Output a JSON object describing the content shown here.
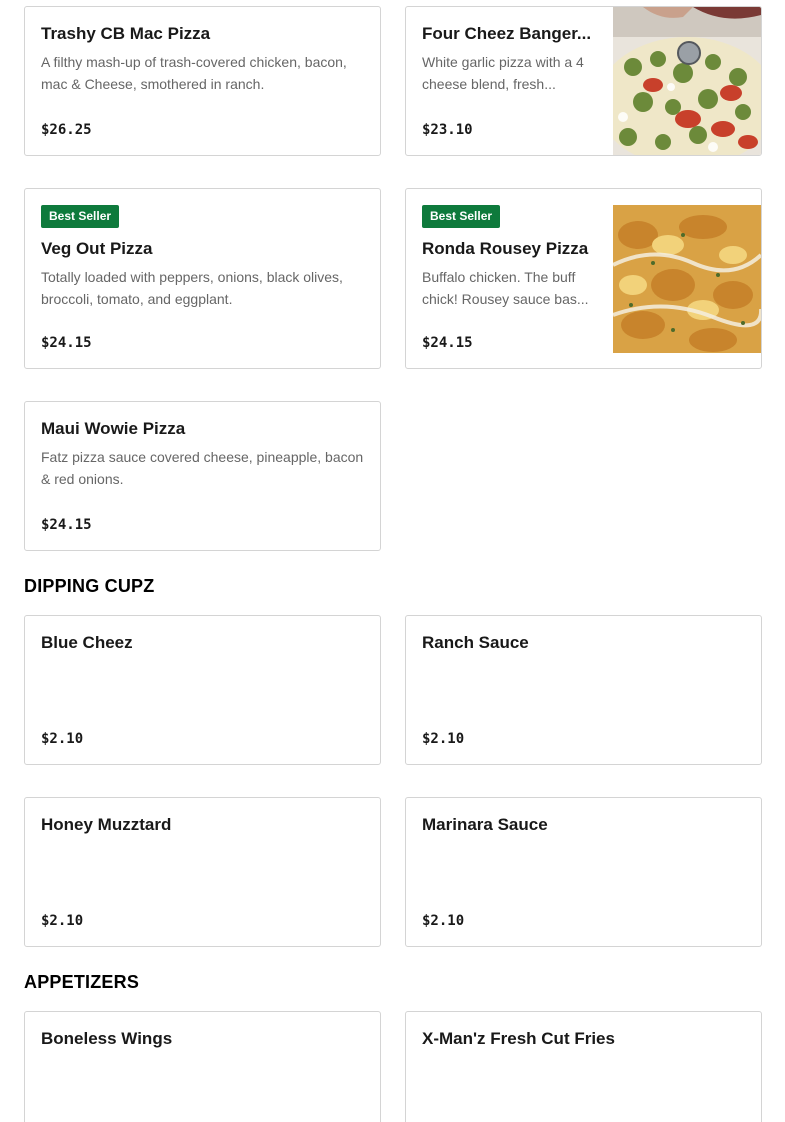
{
  "sections": {
    "pizza": {
      "items": [
        {
          "name": "Trashy CB Mac Pizza",
          "desc": "A filthy mash-up of trash-covered chicken, bacon, mac & Cheese, smothered in ranch.",
          "price": "$26.25"
        },
        {
          "name": "Four Cheez Banger...",
          "desc": "White garlic pizza with a 4 cheese blend, fresh...",
          "price": "$23.10",
          "image": "pizza-with-tomato-and-pesto-photo"
        },
        {
          "badge": "Best Seller",
          "name": "Veg Out Pizza",
          "desc": "Totally loaded with peppers, onions, black olives, broccoli, tomato, and eggplant.",
          "price": "$24.15"
        },
        {
          "badge": "Best Seller",
          "name": "Ronda Rousey Pizza",
          "desc": "Buffalo chicken. The buff chick! Rousey sauce bas...",
          "price": "$24.15",
          "image": "buffalo-chicken-pizza-photo"
        },
        {
          "name": "Maui Wowie Pizza",
          "desc": "Fatz pizza sauce covered cheese, pineapple, bacon & red onions.",
          "price": "$24.15"
        }
      ]
    },
    "dipping": {
      "title": "DIPPING CUPZ",
      "items": [
        {
          "name": "Blue Cheez",
          "price": "$2.10"
        },
        {
          "name": "Ranch Sauce",
          "price": "$2.10"
        },
        {
          "name": "Honey Muzztard",
          "price": "$2.10"
        },
        {
          "name": "Marinara Sauce",
          "price": "$2.10"
        }
      ]
    },
    "appetizers": {
      "title": "APPETIZERS",
      "items": [
        {
          "name": "Boneless Wings"
        },
        {
          "name": "X-Man'z Fresh Cut Fries"
        }
      ]
    }
  },
  "colors": {
    "badge_bg": "#0e7a3c",
    "card_border": "#d4d4d4",
    "desc_text": "#666666"
  }
}
